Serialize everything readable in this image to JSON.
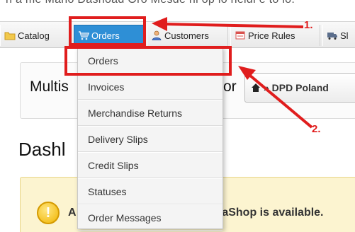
{
  "tabs": [
    {
      "label": "Catalog",
      "icon": "folder-icon"
    },
    {
      "label": "Orders",
      "icon": "cart-icon",
      "active": true
    },
    {
      "label": "Customers",
      "icon": "customers-icon"
    },
    {
      "label": "Price Rules",
      "icon": "price-tag-icon"
    },
    {
      "label": "Sl",
      "icon": "truck-icon"
    }
  ],
  "orders_menu": {
    "items": [
      "Orders",
      "Invoices",
      "Merchandise Returns",
      "Delivery Slips",
      "Credit Slips",
      "Statuses",
      "Order Messages"
    ]
  },
  "multistore": {
    "label_start": "Multis",
    "label_end": "or",
    "shop_value": "» DPD Poland"
  },
  "page": {
    "heading": "Dashl"
  },
  "alert": {
    "text_start": "A",
    "text": "taShop is available."
  },
  "annotations": {
    "step_1": "1.",
    "step_2": "2.",
    "color": "#e01d1d"
  },
  "colors": {
    "active_tab": "#2e8fd6",
    "alert_background": "#fcf4d0"
  }
}
